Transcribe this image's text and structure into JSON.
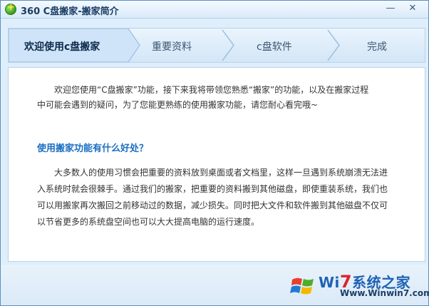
{
  "window": {
    "title": "360 C盘搬家-搬家简介"
  },
  "titlebar_buttons": {
    "minimize": "—",
    "close": "✕"
  },
  "steps": [
    {
      "label": "欢迎使用c盘搬家",
      "active": true
    },
    {
      "label": "重要资料",
      "active": false
    },
    {
      "label": "c盘软件",
      "active": false
    },
    {
      "label": "完成",
      "active": false
    }
  ],
  "content": {
    "intro_line1": "欢迎您使用“C盘搬家”功能，接下来我将带领您熟悉“搬家”的功能，以及在搬家过程",
    "intro_line2": "中可能会遇到的疑问，为了您能更熟练的使用搬家功能，请您耐心看完哦~",
    "heading": "使用搬家功能有什么好处？",
    "body_lines": [
      "大多数人的使用习惯会把重要的资料放到桌面或者文档里，这样一旦遇到系统崩溃无法进",
      "入系统时就会很棘手。通过我们的搬家，把重要的资料搬到其他磁盘，即使重装系统，我们也",
      "可以用搬家再次搬回之前移动过的数据，减少损失。同时把大文件和软件搬到其他磁盘不仅可",
      "以节省更多的系统盘空间也可以大大提高电脑的运行速度。"
    ]
  },
  "watermark": {
    "brand_prefix": "Wi",
    "brand_seven": "7",
    "brand_suffix": "系统之家",
    "url": "Www.Winwin7.com"
  },
  "colors": {
    "accent": "#1a6ec2",
    "frame": "#5a8fbf",
    "background": "#dfeefb"
  }
}
